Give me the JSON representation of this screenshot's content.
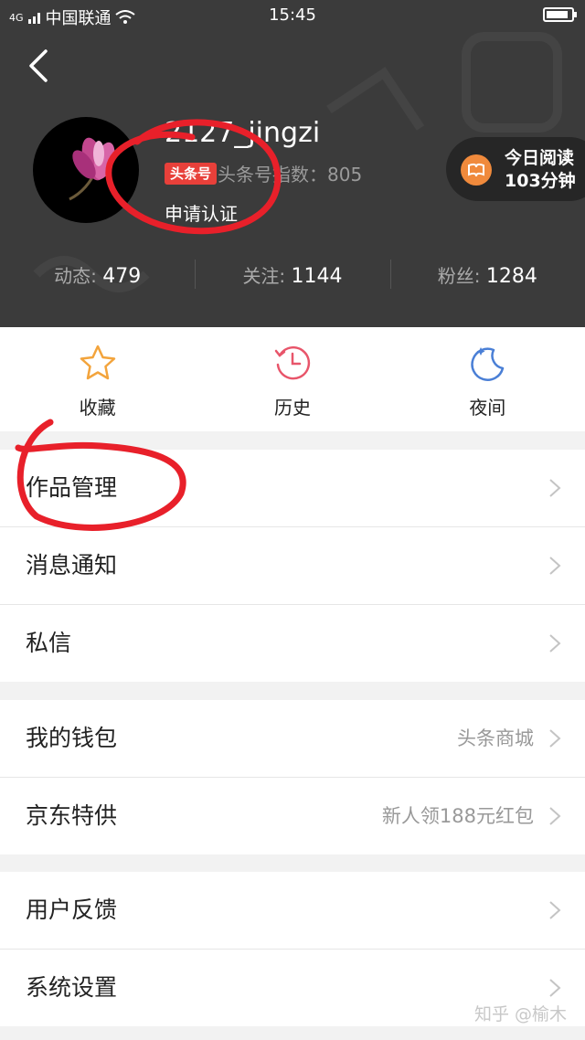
{
  "status_bar": {
    "network": "4G",
    "carrier": "中国联通",
    "time": "15:45",
    "battery_level": 0.9
  },
  "profile": {
    "username": "2127_jingzi",
    "badge": "头条号",
    "index_text": "头条号指数：805",
    "verify_link": "申请认证",
    "reading_line1": "今日阅读",
    "reading_line2": "103分钟"
  },
  "stats": [
    {
      "label": "动态:",
      "value": "479"
    },
    {
      "label": "关注:",
      "value": "1144"
    },
    {
      "label": "粉丝:",
      "value": "1284"
    }
  ],
  "quick_actions": [
    {
      "label": "收藏",
      "icon": "star-icon"
    },
    {
      "label": "历史",
      "icon": "clock-icon"
    },
    {
      "label": "夜间",
      "icon": "moon-icon"
    }
  ],
  "menu": {
    "group1": [
      {
        "label": "作品管理"
      },
      {
        "label": "消息通知"
      },
      {
        "label": "私信"
      }
    ],
    "group2": [
      {
        "label": "我的钱包",
        "value": "头条商城"
      },
      {
        "label": "京东特供",
        "value": "新人领188元红包"
      }
    ],
    "group3": [
      {
        "label": "用户反馈"
      },
      {
        "label": "系统设置"
      }
    ]
  },
  "watermark": "知乎 @榆木",
  "colors": {
    "header_bg": "#3b3b3b",
    "badge_red": "#e8403a",
    "annotation_red": "#e8202a",
    "accent_orange": "#f08a3c"
  }
}
